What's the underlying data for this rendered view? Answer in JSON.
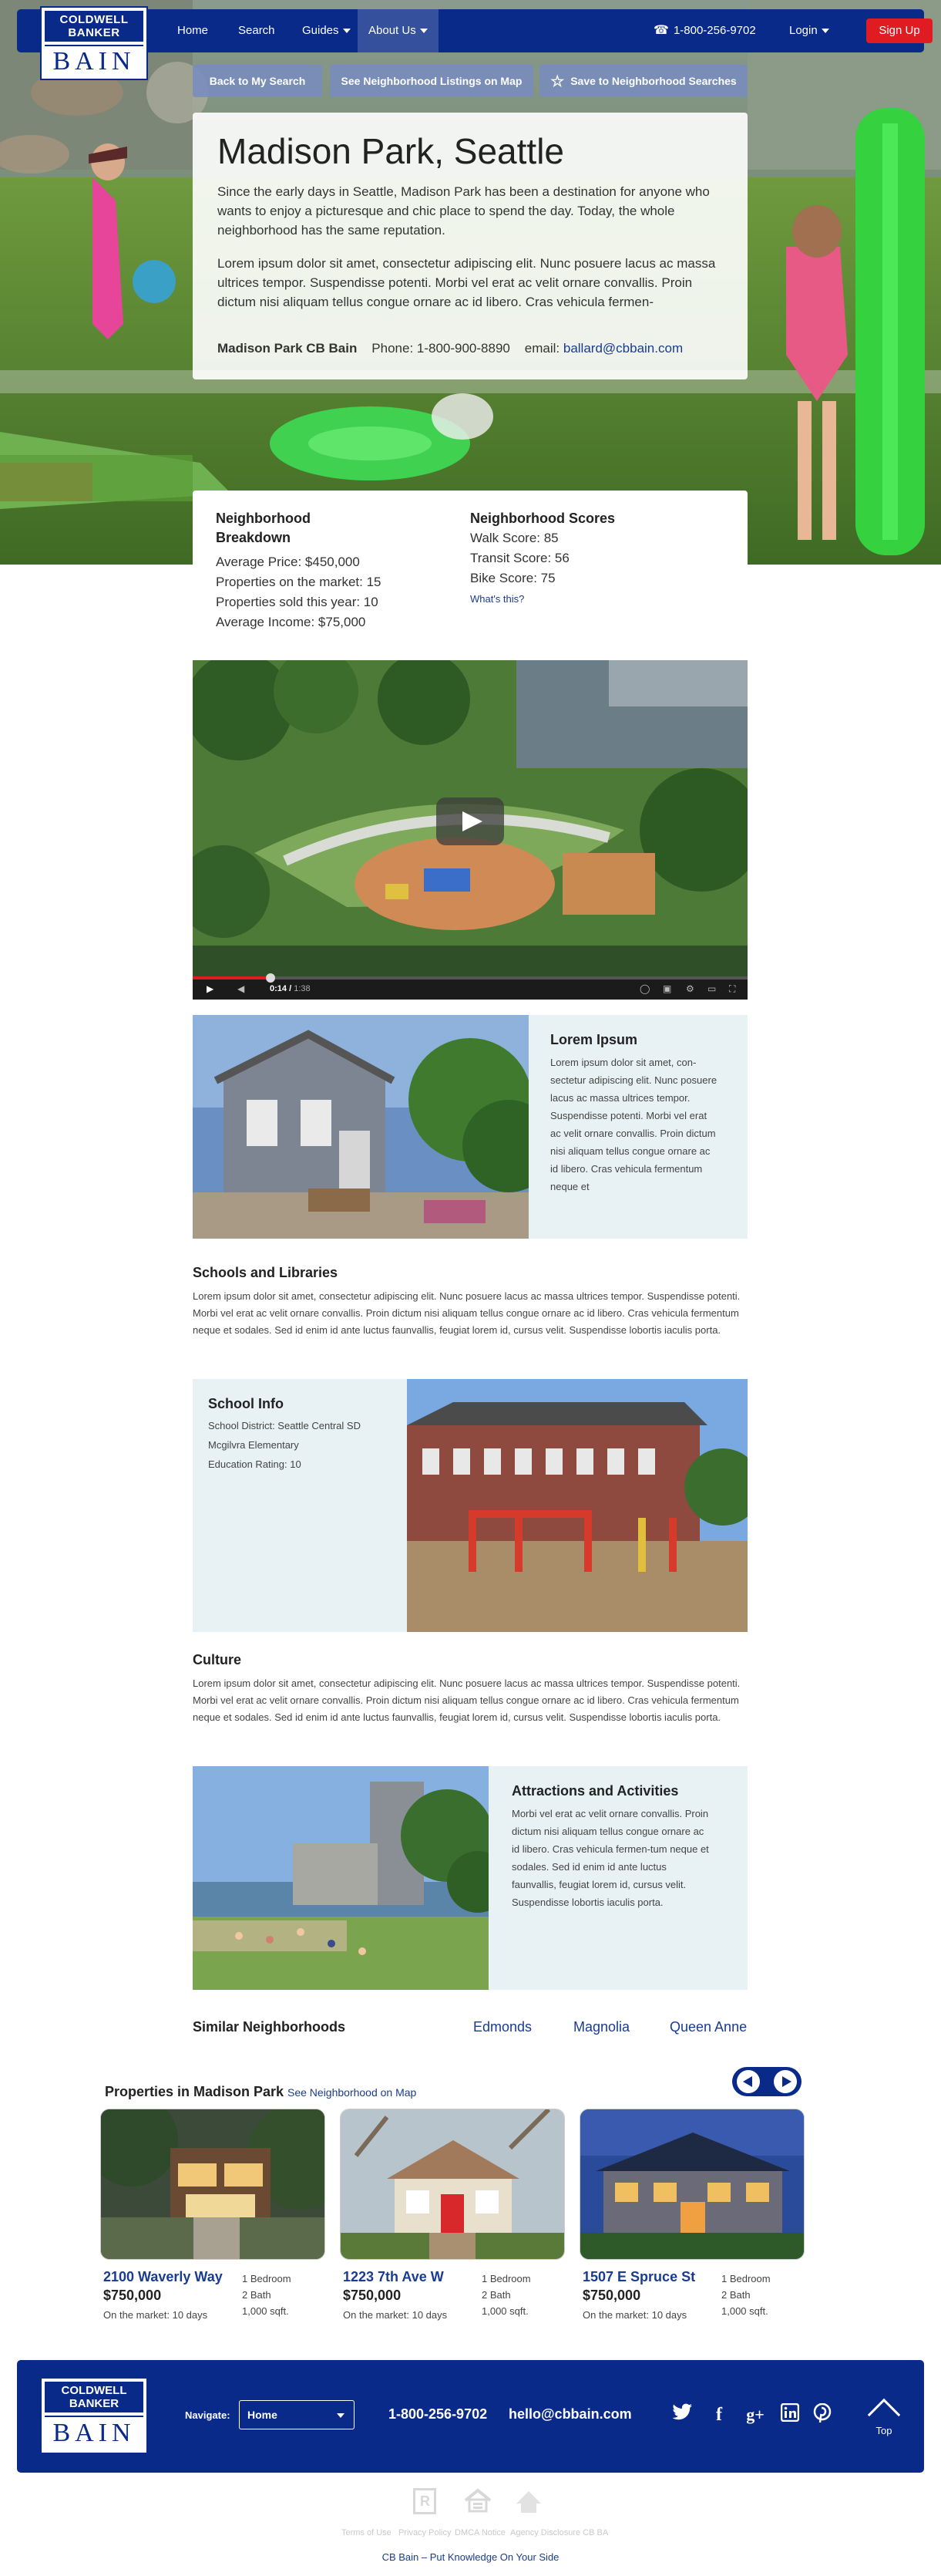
{
  "nav": {
    "logo_top": "COLDWELL BANKER",
    "logo_bottom": "BAIN",
    "items": [
      "Home",
      "Search",
      "Guides",
      "About Us"
    ],
    "phone": "1-800-256-9702",
    "login": "Login",
    "signup": "Sign Up"
  },
  "hero": {
    "buttons": [
      "Back to My Search",
      "See Neighborhood Listings on Map",
      "Save to Neighborhood Searches"
    ],
    "title": "Madison Park, Seattle",
    "intro": "Since the early days in Seattle, Madison Park has been a destination for anyone who wants to enjoy a picturesque and chic place to spend the day. Today, the whole neighborhood has the same reputation.",
    "lorem": "Lorem ipsum dolor sit amet, consectetur adipiscing elit. Nunc posuere lacus ac massa ultrices tempor. Suspendisse potenti. Morbi vel erat ac velit ornare convallis. Proin dictum nisi aliquam tellus congue ornare ac id libero. Cras vehicula fermen-",
    "contact_name": "Madison Park CB Bain",
    "contact_phone": "Phone: 1-800-900-8890",
    "contact_email_label": "email:",
    "contact_email": "ballard@cbbain.com"
  },
  "breakdown": {
    "title": "Neighborhood Breakdown",
    "lines": [
      "Average Price: $450,000",
      "Properties on the market: 15",
      "Properties sold this year: 10",
      "Average Income: $75,000"
    ],
    "scores_title": "Neighborhood Scores",
    "scores": [
      "Walk Score: 85",
      "Transit Score: 56",
      "Bike Score: 75"
    ],
    "whats_this": "What's this?"
  },
  "video": {
    "current": "0:14",
    "total": "1:38",
    "progress": 0.14
  },
  "panel1": {
    "title": "Lorem Ipsum",
    "text": "Lorem ipsum dolor sit amet, con-sectetur adipiscing elit. Nunc posuere lacus ac massa ultrices tempor. Suspendisse potenti. Morbi vel erat ac velit ornare convallis. Proin dictum nisi aliquam tellus congue ornare ac id libero. Cras vehicula fermentum neque et"
  },
  "schools": {
    "title": "Schools and Libraries",
    "text": "Lorem ipsum dolor sit amet, consectetur adipiscing elit. Nunc posuere lacus ac massa ultrices tempor. Suspendisse potenti. Morbi vel erat ac velit ornare convallis. Proin dictum nisi aliquam tellus congue ornare ac id libero. Cras vehicula fermentum neque et sodales. Sed id enim id ante luctus faunvallis, feugiat lorem id, cursus velit. Suspendisse lobortis iaculis porta."
  },
  "school_info": {
    "title": "School Info",
    "lines": [
      "School District: Seattle Central SD",
      "Mcgilvra Elementary",
      "Education Rating: 10"
    ]
  },
  "culture": {
    "title": "Culture",
    "text": "Lorem ipsum dolor sit amet, consectetur adipiscing elit. Nunc posuere lacus ac massa ultrices tempor. Suspendisse potenti. Morbi vel erat ac velit ornare convallis. Proin dictum nisi aliquam tellus congue ornare ac id libero. Cras vehicula fermentum neque et sodales. Sed id enim id ante luctus faunvallis, feugiat lorem id, cursus velit. Suspendisse lobortis iaculis porta."
  },
  "attractions": {
    "title": "Attractions and Activities",
    "text": "Morbi vel erat ac velit ornare convallis. Proin dictum nisi aliquam tellus congue ornare ac id libero. Cras vehicula fermen-tum neque et sodales. Sed id enim id ante luctus faunvallis, feugiat lorem id, cursus velit. Suspendisse lobortis iaculis porta."
  },
  "similar": {
    "title": "Similar Neighborhoods",
    "links": [
      "Edmonds",
      "Magnolia",
      "Queen Anne"
    ]
  },
  "properties": {
    "title": "Properties in Madison Park",
    "map_link": "See Neighborhood on Map",
    "items": [
      {
        "address": "2100 Waverly Way",
        "price": "$750,000",
        "market": "On the market: 10 days",
        "bed": "1 Bedroom",
        "bath": "2 Bath",
        "sqft": "1,000 sqft."
      },
      {
        "address": "1223 7th Ave W",
        "price": "$750,000",
        "market": "On the market: 10 days",
        "bed": "1 Bedroom",
        "bath": "2 Bath",
        "sqft": "1,000 sqft."
      },
      {
        "address": "1507 E Spruce St",
        "price": "$750,000",
        "market": "On the market: 10 days",
        "bed": "1 Bedroom",
        "bath": "2 Bath",
        "sqft": "1,000 sqft."
      }
    ]
  },
  "footer": {
    "logo_top": "COLDWELL BANKER",
    "logo_bottom": "BAIN",
    "navigate_label": "Navigate:",
    "navigate_value": "Home",
    "phone": "1-800-256-9702",
    "email": "hello@cbbain.com",
    "social": [
      "twitter-icon",
      "facebook-icon",
      "google-plus-icon",
      "linkedin-icon",
      "pinterest-icon"
    ],
    "top": "Top",
    "links": [
      "Terms of Use",
      "Privacy Policy",
      "DMCA Notice",
      "Agency Disclosure CB BA"
    ],
    "tagline": "CB Bain – Put Knowledge On Your Side"
  },
  "colors": {
    "brand_blue": "#0a2a8a",
    "signup_red": "#e11b22",
    "link_blue": "#1a3c8e",
    "panel_bg": "#e8f1f3"
  }
}
